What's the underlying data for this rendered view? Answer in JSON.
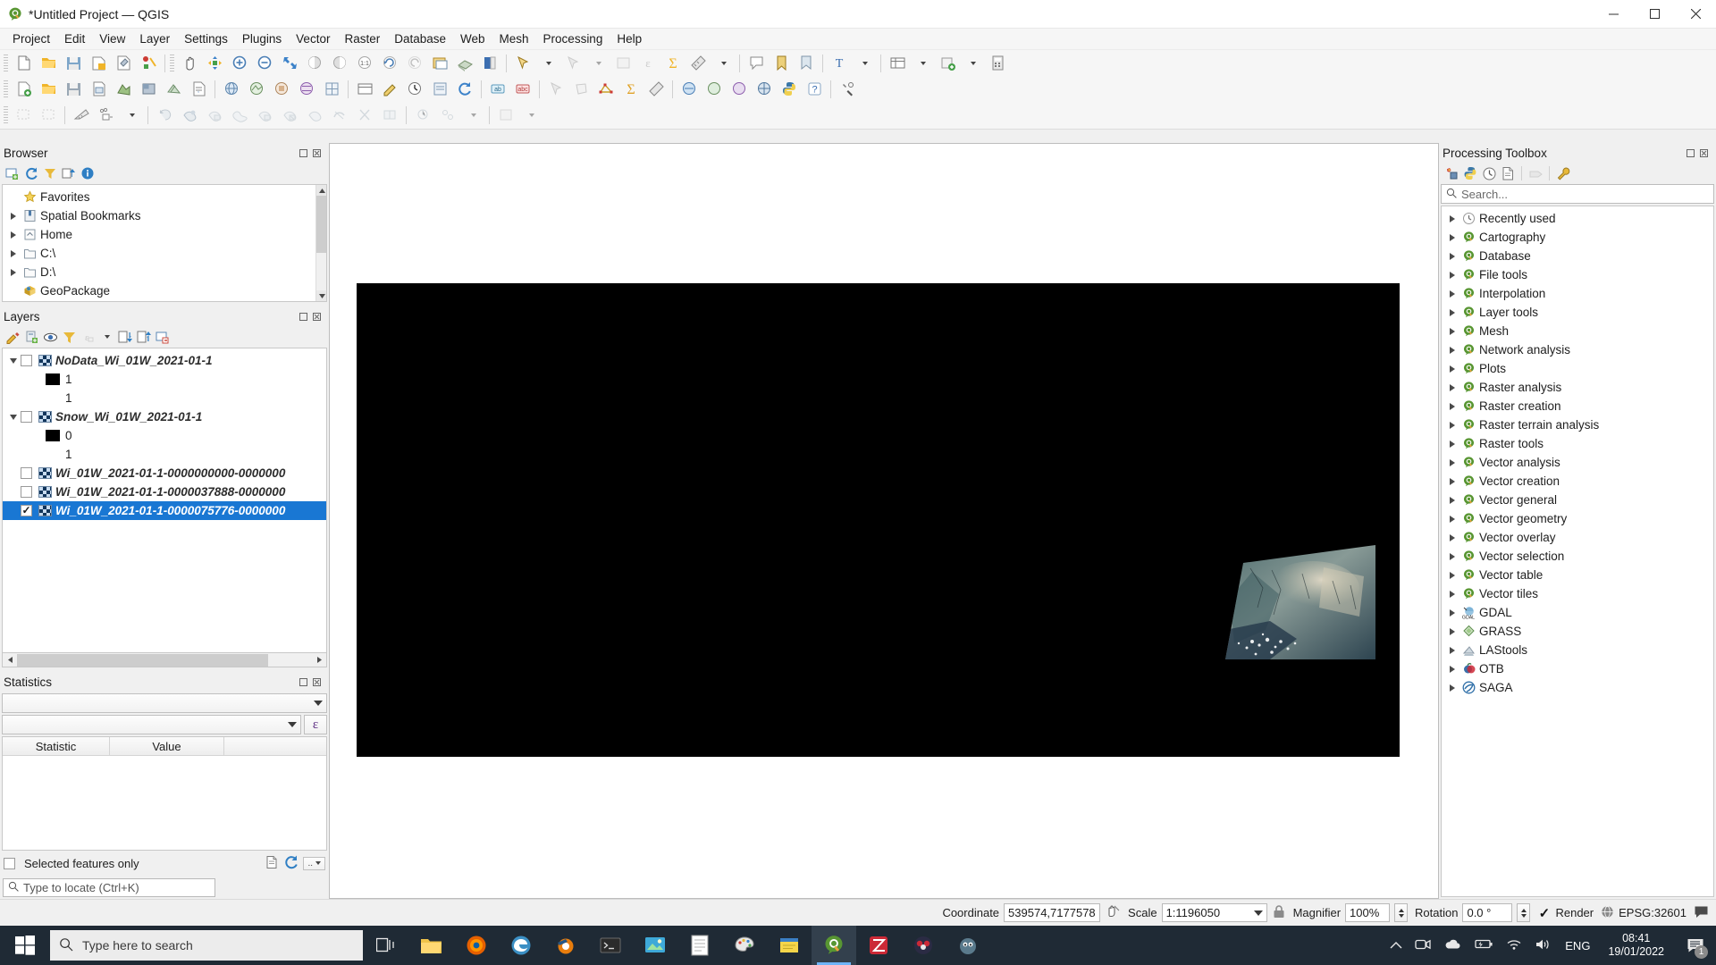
{
  "window": {
    "title": "*Untitled Project — QGIS",
    "app_icon": "qgis-icon",
    "minimize": "–",
    "maximize": "▢",
    "close": "✕"
  },
  "menubar": {
    "items": [
      {
        "label": "Project"
      },
      {
        "label": "Edit"
      },
      {
        "label": "View"
      },
      {
        "label": "Layer"
      },
      {
        "label": "Settings"
      },
      {
        "label": "Plugins"
      },
      {
        "label": "Vector"
      },
      {
        "label": "Raster"
      },
      {
        "label": "Database"
      },
      {
        "label": "Web"
      },
      {
        "label": "Mesh"
      },
      {
        "label": "Processing"
      },
      {
        "label": "Help"
      }
    ]
  },
  "browser_panel": {
    "title": "Browser",
    "toolbar": [
      {
        "name": "add-layer-icon"
      },
      {
        "name": "refresh-icon"
      },
      {
        "name": "filter-icon"
      },
      {
        "name": "collapse-all-icon"
      },
      {
        "name": "properties-info-icon"
      }
    ],
    "tree": [
      {
        "label": "Favorites",
        "icon": "star-icon",
        "expandable": false
      },
      {
        "label": "Spatial Bookmarks",
        "icon": "bookmark-icon",
        "expandable": true
      },
      {
        "label": "Home",
        "icon": "home-icon",
        "expandable": true
      },
      {
        "label": "C:\\",
        "icon": "folder-icon",
        "expandable": true
      },
      {
        "label": "D:\\",
        "icon": "folder-icon",
        "expandable": true
      },
      {
        "label": "GeoPackage",
        "icon": "geopackage-icon",
        "expandable": false
      }
    ]
  },
  "layers_panel": {
    "title": "Layers",
    "toolbar": [
      {
        "name": "open-layer-styling-icon"
      },
      {
        "name": "add-group-icon"
      },
      {
        "name": "manage-map-themes-icon"
      },
      {
        "name": "filter-legend-icon"
      },
      {
        "name": "filter-legend-expression-icon"
      },
      {
        "name": "expand-all-icon"
      },
      {
        "name": "collapse-all-icon"
      },
      {
        "name": "remove-layer-icon"
      }
    ],
    "items": [
      {
        "type": "layer",
        "label": "NoData_Wi_01W_2021-01-1",
        "checked": false,
        "expanded": true,
        "icon": "raster-layer-icon"
      },
      {
        "type": "symbol",
        "label": "1",
        "swatch": "black"
      },
      {
        "type": "symbol",
        "label": "1",
        "swatch": "none"
      },
      {
        "type": "layer",
        "label": "Snow_Wi_01W_2021-01-1",
        "checked": false,
        "expanded": true,
        "icon": "raster-layer-icon"
      },
      {
        "type": "symbol",
        "label": "0",
        "swatch": "black"
      },
      {
        "type": "symbol",
        "label": "1",
        "swatch": "none"
      },
      {
        "type": "layer",
        "label": "Wi_01W_2021-01-1-0000000000-0000000",
        "checked": false,
        "expanded": false,
        "icon": "raster-layer-icon"
      },
      {
        "type": "layer",
        "label": "Wi_01W_2021-01-1-0000037888-0000000",
        "checked": false,
        "expanded": false,
        "icon": "raster-layer-icon"
      },
      {
        "type": "layer",
        "label": "Wi_01W_2021-01-1-0000075776-0000000",
        "checked": true,
        "expanded": false,
        "selected": true,
        "icon": "raster-layer-icon"
      }
    ]
  },
  "statistics_panel": {
    "title": "Statistics",
    "layer_select_value": "",
    "field_select_value": "",
    "expression_button": "ε",
    "columns": [
      "Statistic",
      "Value"
    ],
    "rows": [],
    "selected_features_only_label": "Selected features only",
    "selected_features_only_checked": false,
    "footer_icons": [
      {
        "name": "copy-to-clipboard-icon"
      },
      {
        "name": "refresh-icon"
      },
      {
        "name": "options-menu-icon"
      }
    ]
  },
  "locator": {
    "placeholder": "Type to locate (Ctrl+K)",
    "icon": "search-icon"
  },
  "processing_panel": {
    "title": "Processing Toolbox",
    "toolbar": [
      {
        "name": "models-icon"
      },
      {
        "name": "python-scripts-icon"
      },
      {
        "name": "history-icon"
      },
      {
        "name": "results-viewer-icon"
      },
      {
        "name": "edit-features-in-place-icon"
      },
      {
        "name": "options-wrench-icon"
      }
    ],
    "search_placeholder": "Search...",
    "providers": [
      {
        "label": "Recently used",
        "icon": "clock-icon"
      },
      {
        "label": "Cartography",
        "icon": "qgis-icon"
      },
      {
        "label": "Database",
        "icon": "qgis-icon"
      },
      {
        "label": "File tools",
        "icon": "qgis-icon"
      },
      {
        "label": "Interpolation",
        "icon": "qgis-icon"
      },
      {
        "label": "Layer tools",
        "icon": "qgis-icon"
      },
      {
        "label": "Mesh",
        "icon": "qgis-icon"
      },
      {
        "label": "Network analysis",
        "icon": "qgis-icon"
      },
      {
        "label": "Plots",
        "icon": "qgis-icon"
      },
      {
        "label": "Raster analysis",
        "icon": "qgis-icon"
      },
      {
        "label": "Raster creation",
        "icon": "qgis-icon"
      },
      {
        "label": "Raster terrain analysis",
        "icon": "qgis-icon"
      },
      {
        "label": "Raster tools",
        "icon": "qgis-icon"
      },
      {
        "label": "Vector analysis",
        "icon": "qgis-icon"
      },
      {
        "label": "Vector creation",
        "icon": "qgis-icon"
      },
      {
        "label": "Vector general",
        "icon": "qgis-icon"
      },
      {
        "label": "Vector geometry",
        "icon": "qgis-icon"
      },
      {
        "label": "Vector overlay",
        "icon": "qgis-icon"
      },
      {
        "label": "Vector selection",
        "icon": "qgis-icon"
      },
      {
        "label": "Vector table",
        "icon": "qgis-icon"
      },
      {
        "label": "Vector tiles",
        "icon": "qgis-icon"
      },
      {
        "label": "GDAL",
        "icon": "gdal-icon"
      },
      {
        "label": "GRASS",
        "icon": "grass-icon"
      },
      {
        "label": "LAStools",
        "icon": "lastools-icon"
      },
      {
        "label": "OTB",
        "icon": "otb-icon"
      },
      {
        "label": "SAGA",
        "icon": "saga-icon"
      }
    ]
  },
  "statusbar": {
    "coordinate_label": "Coordinate",
    "coordinate_value": "539574,7177578",
    "toggle_extents_icon": "coordinate-toggle-icon",
    "scale_label": "Scale",
    "scale_value": "1:1196050",
    "lock_icon": "lock-scale-icon",
    "magnifier_label": "Magnifier",
    "magnifier_value": "100%",
    "rotation_label": "Rotation",
    "rotation_value": "0.0 °",
    "render_label": "Render",
    "render_checked": true,
    "crs_value": "EPSG:32601",
    "crs_icon": "globe-icon",
    "messages_icon": "message-log-icon"
  },
  "taskbar": {
    "start_icon": "windows-start-icon",
    "search_placeholder": "Type here to search",
    "search_icon": "search-icon",
    "task_view_icon": "task-view-icon",
    "apps": [
      {
        "name": "file-explorer-icon",
        "active": false
      },
      {
        "name": "firefox-icon",
        "active": false
      },
      {
        "name": "edge-icon",
        "active": false
      },
      {
        "name": "blender-icon",
        "active": false
      },
      {
        "name": "terminal-icon",
        "active": false
      },
      {
        "name": "photos-icon",
        "active": false
      },
      {
        "name": "notepad-icon",
        "active": false
      },
      {
        "name": "paint-icon",
        "active": false
      },
      {
        "name": "sticky-notes-icon",
        "active": false
      },
      {
        "name": "qgis-icon",
        "active": true
      },
      {
        "name": "zotero-icon",
        "active": false
      },
      {
        "name": "mendeley-icon",
        "active": false
      },
      {
        "name": "gimp-icon",
        "active": false
      }
    ],
    "tray": [
      {
        "name": "show-hidden-icons-icon"
      },
      {
        "name": "screen-recorder-icon"
      },
      {
        "name": "onedrive-icon"
      },
      {
        "name": "battery-charging-icon"
      },
      {
        "name": "wifi-icon"
      },
      {
        "name": "volume-icon"
      }
    ],
    "language": "ENG",
    "time": "08:41",
    "date": "19/01/2022",
    "notification_icon": "action-center-icon",
    "notification_count": "1"
  },
  "colors": {
    "selection_blue": "#1977d3",
    "taskbar_bg": "#1f2a35",
    "panel_bg": "#f0f0f0",
    "canvas_bg": "#ffffff",
    "raster_black": "#000000",
    "qgis_green": "#589632"
  }
}
